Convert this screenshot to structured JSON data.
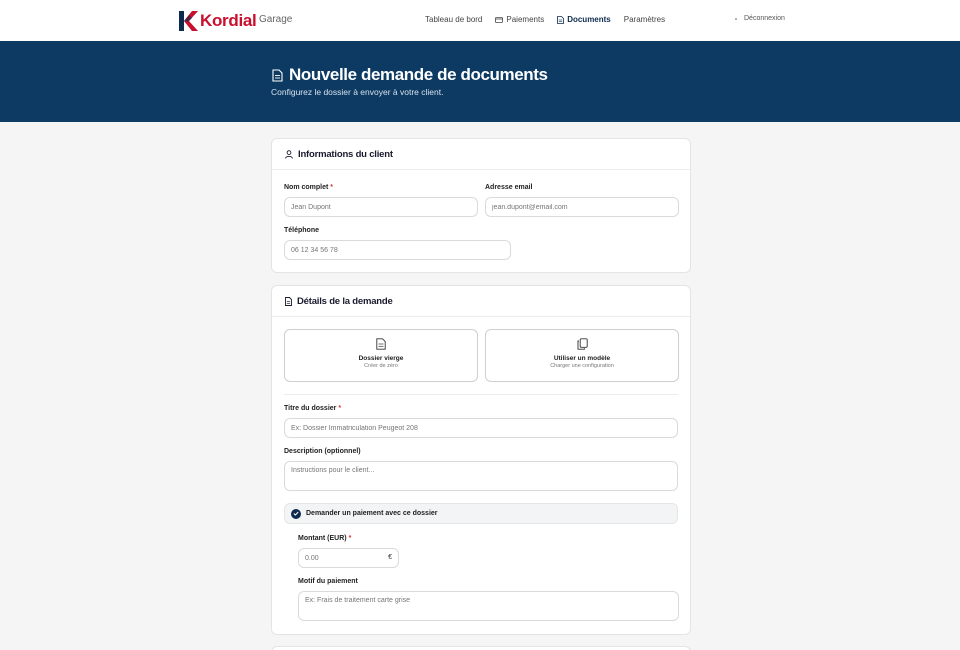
{
  "brand": {
    "name": "Kordial",
    "app": "Garage",
    "accent": "#c8102e",
    "primary": "#0d3a62"
  },
  "nav": {
    "items": [
      {
        "label": "Tableau de bord",
        "icon": ""
      },
      {
        "label": "Paiements",
        "icon": "card-icon"
      },
      {
        "label": "Documents",
        "icon": "document-icon"
      },
      {
        "label": "Paramètres",
        "icon": ""
      }
    ],
    "logout": "Déconnexion"
  },
  "hero": {
    "title": "Nouvelle demande de documents",
    "subtitle": "Configurez le dossier à envoyer à votre client."
  },
  "client": {
    "title": "Informations du client",
    "name_label": "Nom complet",
    "name_placeholder": "Jean Dupont",
    "email_label": "Adresse email",
    "email_placeholder": "jean.dupont@email.com",
    "phone_label": "Téléphone",
    "phone_placeholder": "06 12 34 56 78"
  },
  "details": {
    "title": "Détails de la demande",
    "blank_title": "Dossier vierge",
    "blank_sub": "Créer de zéro",
    "template_title": "Utiliser un modèle",
    "template_sub": "Charger une configuration",
    "file_title_label": "Titre du dossier",
    "file_title_placeholder": "Ex: Dossier Immatriculation Peugeot 208",
    "description_label": "Description (optionnel)",
    "description_placeholder": "Instructions pour le client...",
    "payment_toggle": "Demander un paiement avec ce dossier",
    "amount_label": "Montant (EUR)",
    "amount_placeholder": "0.00",
    "currency": "€",
    "reason_label": "Motif du paiement",
    "reason_placeholder": "Ex: Frais de traitement carte grise"
  },
  "required_mark": "*"
}
